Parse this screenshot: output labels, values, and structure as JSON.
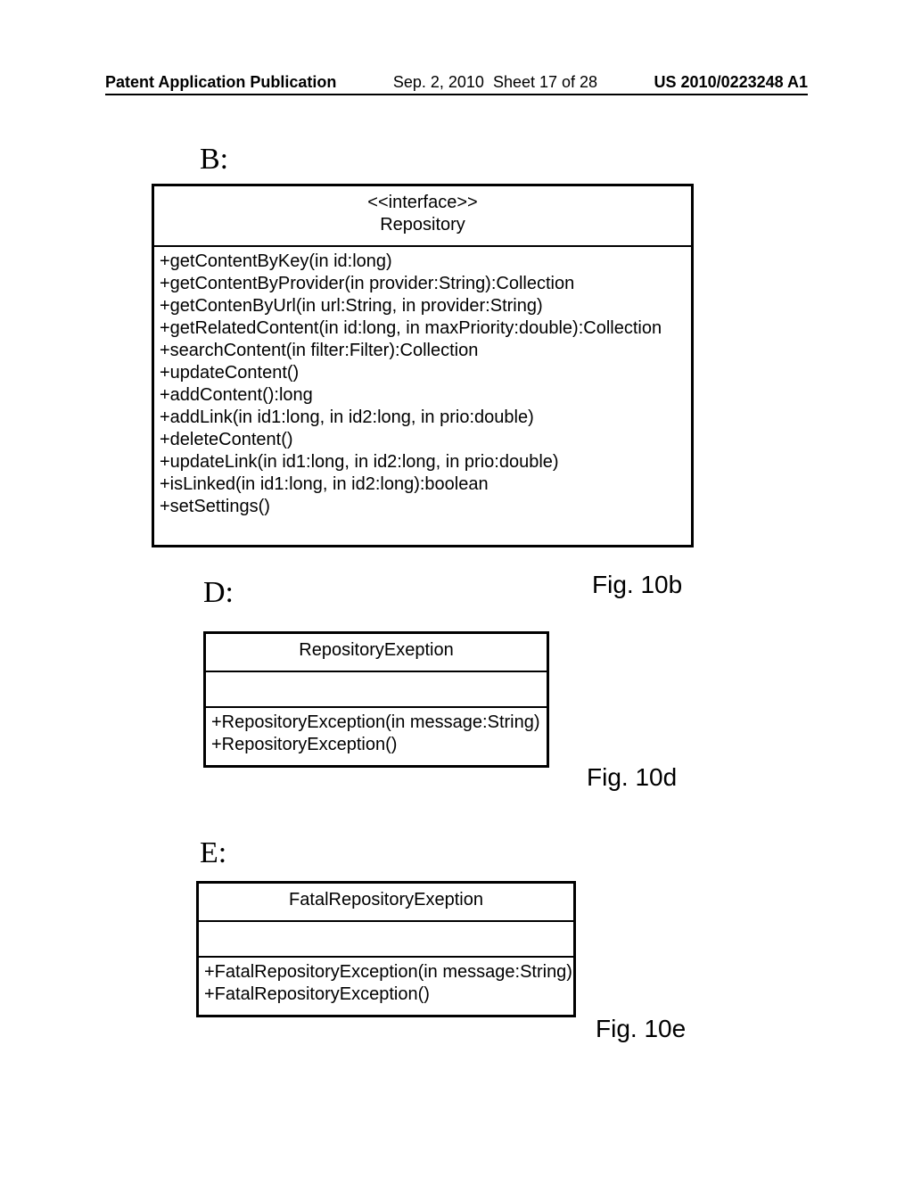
{
  "header": {
    "left": "Patent Application Publication",
    "date": "Sep. 2, 2010",
    "sheet": "Sheet 17 of 28",
    "pubno": "US 2010/0223248 A1"
  },
  "sectionB": {
    "label": "B:",
    "stereotype": "<<interface>>",
    "name": "Repository",
    "ops": [
      "+getContentByKey(in id:long)",
      "+getContentByProvider(in provider:String):Collection",
      "+getContenByUrl(in url:String, in provider:String)",
      "+getRelatedContent(in id:long, in maxPriority:double):Collection",
      "+searchContent(in filter:Filter):Collection",
      "+updateContent()",
      "+addContent():long",
      "+addLink(in id1:long, in id2:long, in prio:double)",
      "+deleteContent()",
      "+updateLink(in id1:long, in id2:long, in prio:double)",
      "+isLinked(in id1:long, in id2:long):boolean",
      "+setSettings()"
    ],
    "caption": "Fig. 10b"
  },
  "sectionD": {
    "label": "D:",
    "name": "RepositoryExeption",
    "ops": [
      "+RepositoryException(in message:String)",
      "+RepositoryException()"
    ],
    "caption": "Fig. 10d"
  },
  "sectionE": {
    "label": "E:",
    "name": "FatalRepositoryExeption",
    "ops": [
      "+FatalRepositoryException(in message:String)",
      "+FatalRepositoryException()"
    ],
    "caption": "Fig. 10e"
  }
}
